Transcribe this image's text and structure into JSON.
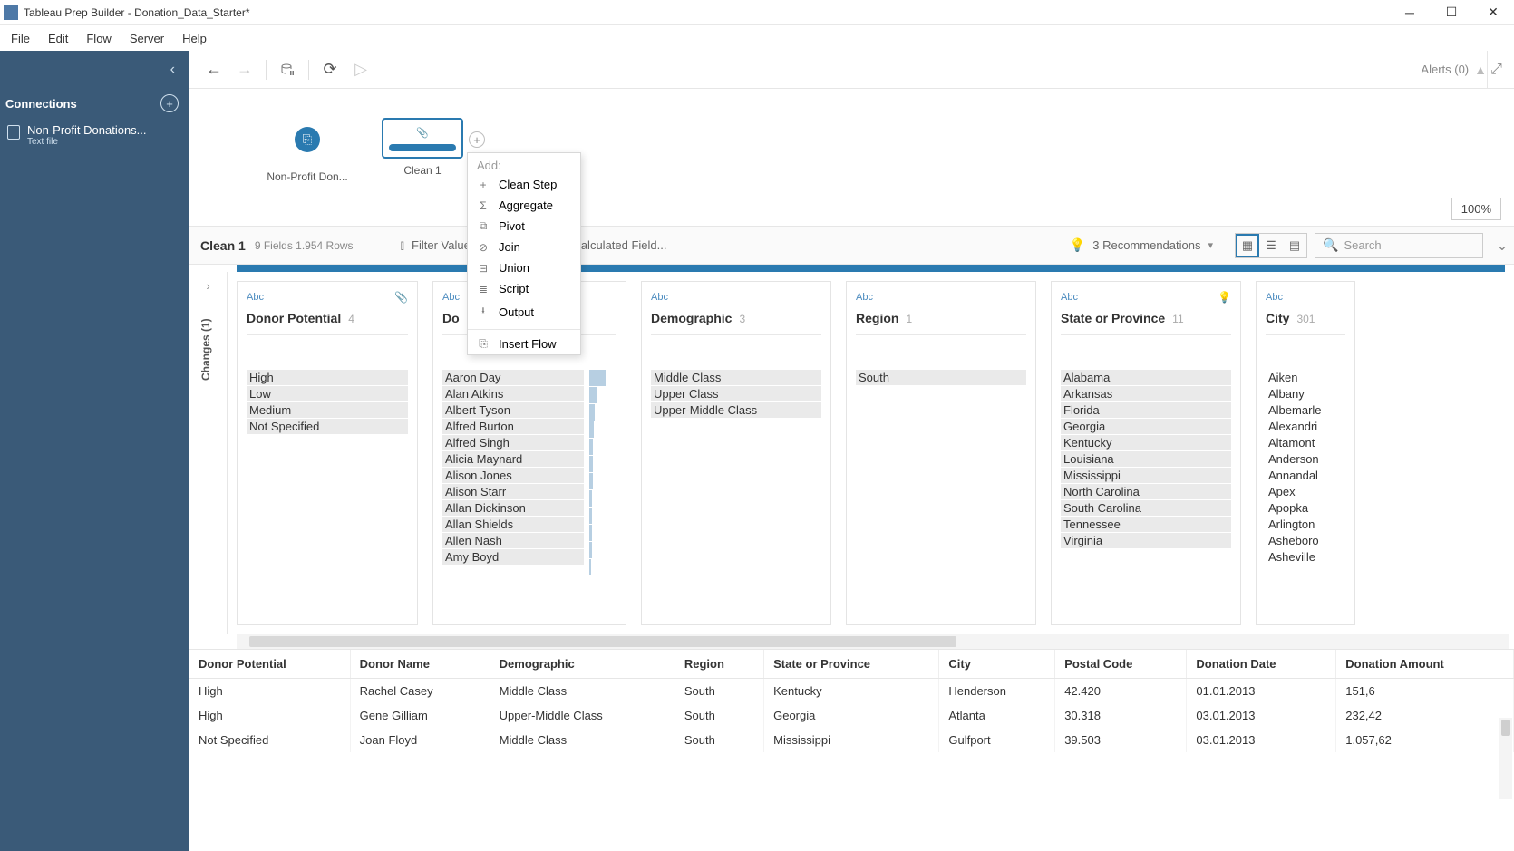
{
  "titlebar": {
    "app": "Tableau Prep Builder",
    "doc": "Donation_Data_Starter*"
  },
  "menu": [
    "File",
    "Edit",
    "Flow",
    "Server",
    "Help"
  ],
  "sidebar": {
    "collapse_glyph": "‹",
    "section": "Connections",
    "conn": {
      "name": "Non-Profit Donations...",
      "sub": "Text file"
    }
  },
  "toolbar": {
    "alerts": "Alerts (0)"
  },
  "canvas": {
    "source_label": "Non-Profit Don...",
    "clean_label": "Clean 1",
    "zoom": "100%"
  },
  "ctxmenu": {
    "header": "Add:",
    "items": [
      "Clean Step",
      "Aggregate",
      "Pivot",
      "Join",
      "Union",
      "Script",
      "Output"
    ],
    "icons": [
      "+",
      "Σ",
      "⧉",
      "⊘",
      "⊟",
      "≣",
      "⭳"
    ],
    "insert": "Insert Flow",
    "insert_icon": "⎘"
  },
  "stepbar": {
    "name": "Clean 1",
    "meta": "9 Fields   1.954 Rows",
    "filter": "Filter Value",
    "calc_tail": "alculated Field...",
    "recs": "3 Recommendations",
    "search": "Search"
  },
  "changes_tab": "Changes (1)",
  "profile": {
    "type_abc": "Abc",
    "cards": [
      {
        "field": "Donor Potential",
        "count": "4",
        "icon": "clip",
        "values": [
          {
            "t": "High",
            "h": 1
          },
          {
            "t": "Low",
            "h": 1
          },
          {
            "t": "Medium",
            "h": 1
          },
          {
            "t": "Not Specified",
            "h": 1
          }
        ]
      },
      {
        "field": "Do",
        "truncated": true,
        "values": [
          {
            "t": "Aaron Day",
            "w": 18
          },
          {
            "t": "Alan Atkins",
            "w": 8
          },
          {
            "t": "Albert Tyson",
            "w": 6
          },
          {
            "t": "Alfred Burton",
            "w": 5
          },
          {
            "t": "Alfred Singh",
            "w": 4
          },
          {
            "t": "Alicia Maynard",
            "w": 4
          },
          {
            "t": "Alison Jones",
            "w": 4
          },
          {
            "t": "Alison Starr",
            "w": 3
          },
          {
            "t": "Allan Dickinson",
            "w": 3
          },
          {
            "t": "Allan Shields",
            "w": 3
          },
          {
            "t": "Allen Nash",
            "w": 3
          },
          {
            "t": "Amy Boyd",
            "w": 2
          }
        ]
      },
      {
        "field": "Demographic",
        "count": "3",
        "values": [
          {
            "t": "Middle Class",
            "h": 1
          },
          {
            "t": "Upper Class",
            "h": 1
          },
          {
            "t": "Upper-Middle Class",
            "h": 1
          }
        ]
      },
      {
        "field": "Region",
        "count": "1",
        "values": [
          {
            "t": "South",
            "h": 1
          }
        ]
      },
      {
        "field": "State or Province",
        "count": "11",
        "icon": "bulb",
        "values": [
          {
            "t": "Alabama",
            "h": 1
          },
          {
            "t": "Arkansas",
            "h": 1
          },
          {
            "t": "Florida",
            "h": 1
          },
          {
            "t": "Georgia",
            "h": 1
          },
          {
            "t": "Kentucky",
            "h": 1
          },
          {
            "t": "Louisiana",
            "h": 1
          },
          {
            "t": "Mississippi",
            "h": 1
          },
          {
            "t": "North Carolina",
            "h": 1
          },
          {
            "t": "South Carolina",
            "h": 1
          },
          {
            "t": "Tennessee",
            "h": 1
          },
          {
            "t": "Virginia",
            "h": 1
          }
        ]
      },
      {
        "field": "City",
        "count": "301",
        "values": [
          {
            "t": "Aiken",
            "h": 0
          },
          {
            "t": "Albany",
            "h": 0
          },
          {
            "t": "Albemarle",
            "h": 0
          },
          {
            "t": "Alexandri",
            "h": 0
          },
          {
            "t": "Altamont",
            "h": 0
          },
          {
            "t": "Anderson",
            "h": 0
          },
          {
            "t": "Annandal",
            "h": 0
          },
          {
            "t": "Apex",
            "h": 0
          },
          {
            "t": "Apopka",
            "h": 0
          },
          {
            "t": "Arlington",
            "h": 0
          },
          {
            "t": "Asheboro",
            "h": 0
          },
          {
            "t": "Asheville",
            "h": 0
          }
        ]
      }
    ]
  },
  "grid": {
    "headers": [
      "Donor Potential",
      "Donor Name",
      "Demographic",
      "Region",
      "State or Province",
      "City",
      "Postal Code",
      "Donation Date",
      "Donation Amount"
    ],
    "rows": [
      [
        "High",
        "Rachel Casey",
        "Middle Class",
        "South",
        "Kentucky",
        "Henderson",
        "42.420",
        "01.01.2013",
        "151,6"
      ],
      [
        "High",
        "Gene Gilliam",
        "Upper-Middle Class",
        "South",
        "Georgia",
        "Atlanta",
        "30.318",
        "03.01.2013",
        "232,42"
      ],
      [
        "Not Specified",
        "Joan Floyd",
        "Middle Class",
        "South",
        "Mississippi",
        "Gulfport",
        "39.503",
        "03.01.2013",
        "1.057,62"
      ]
    ]
  }
}
